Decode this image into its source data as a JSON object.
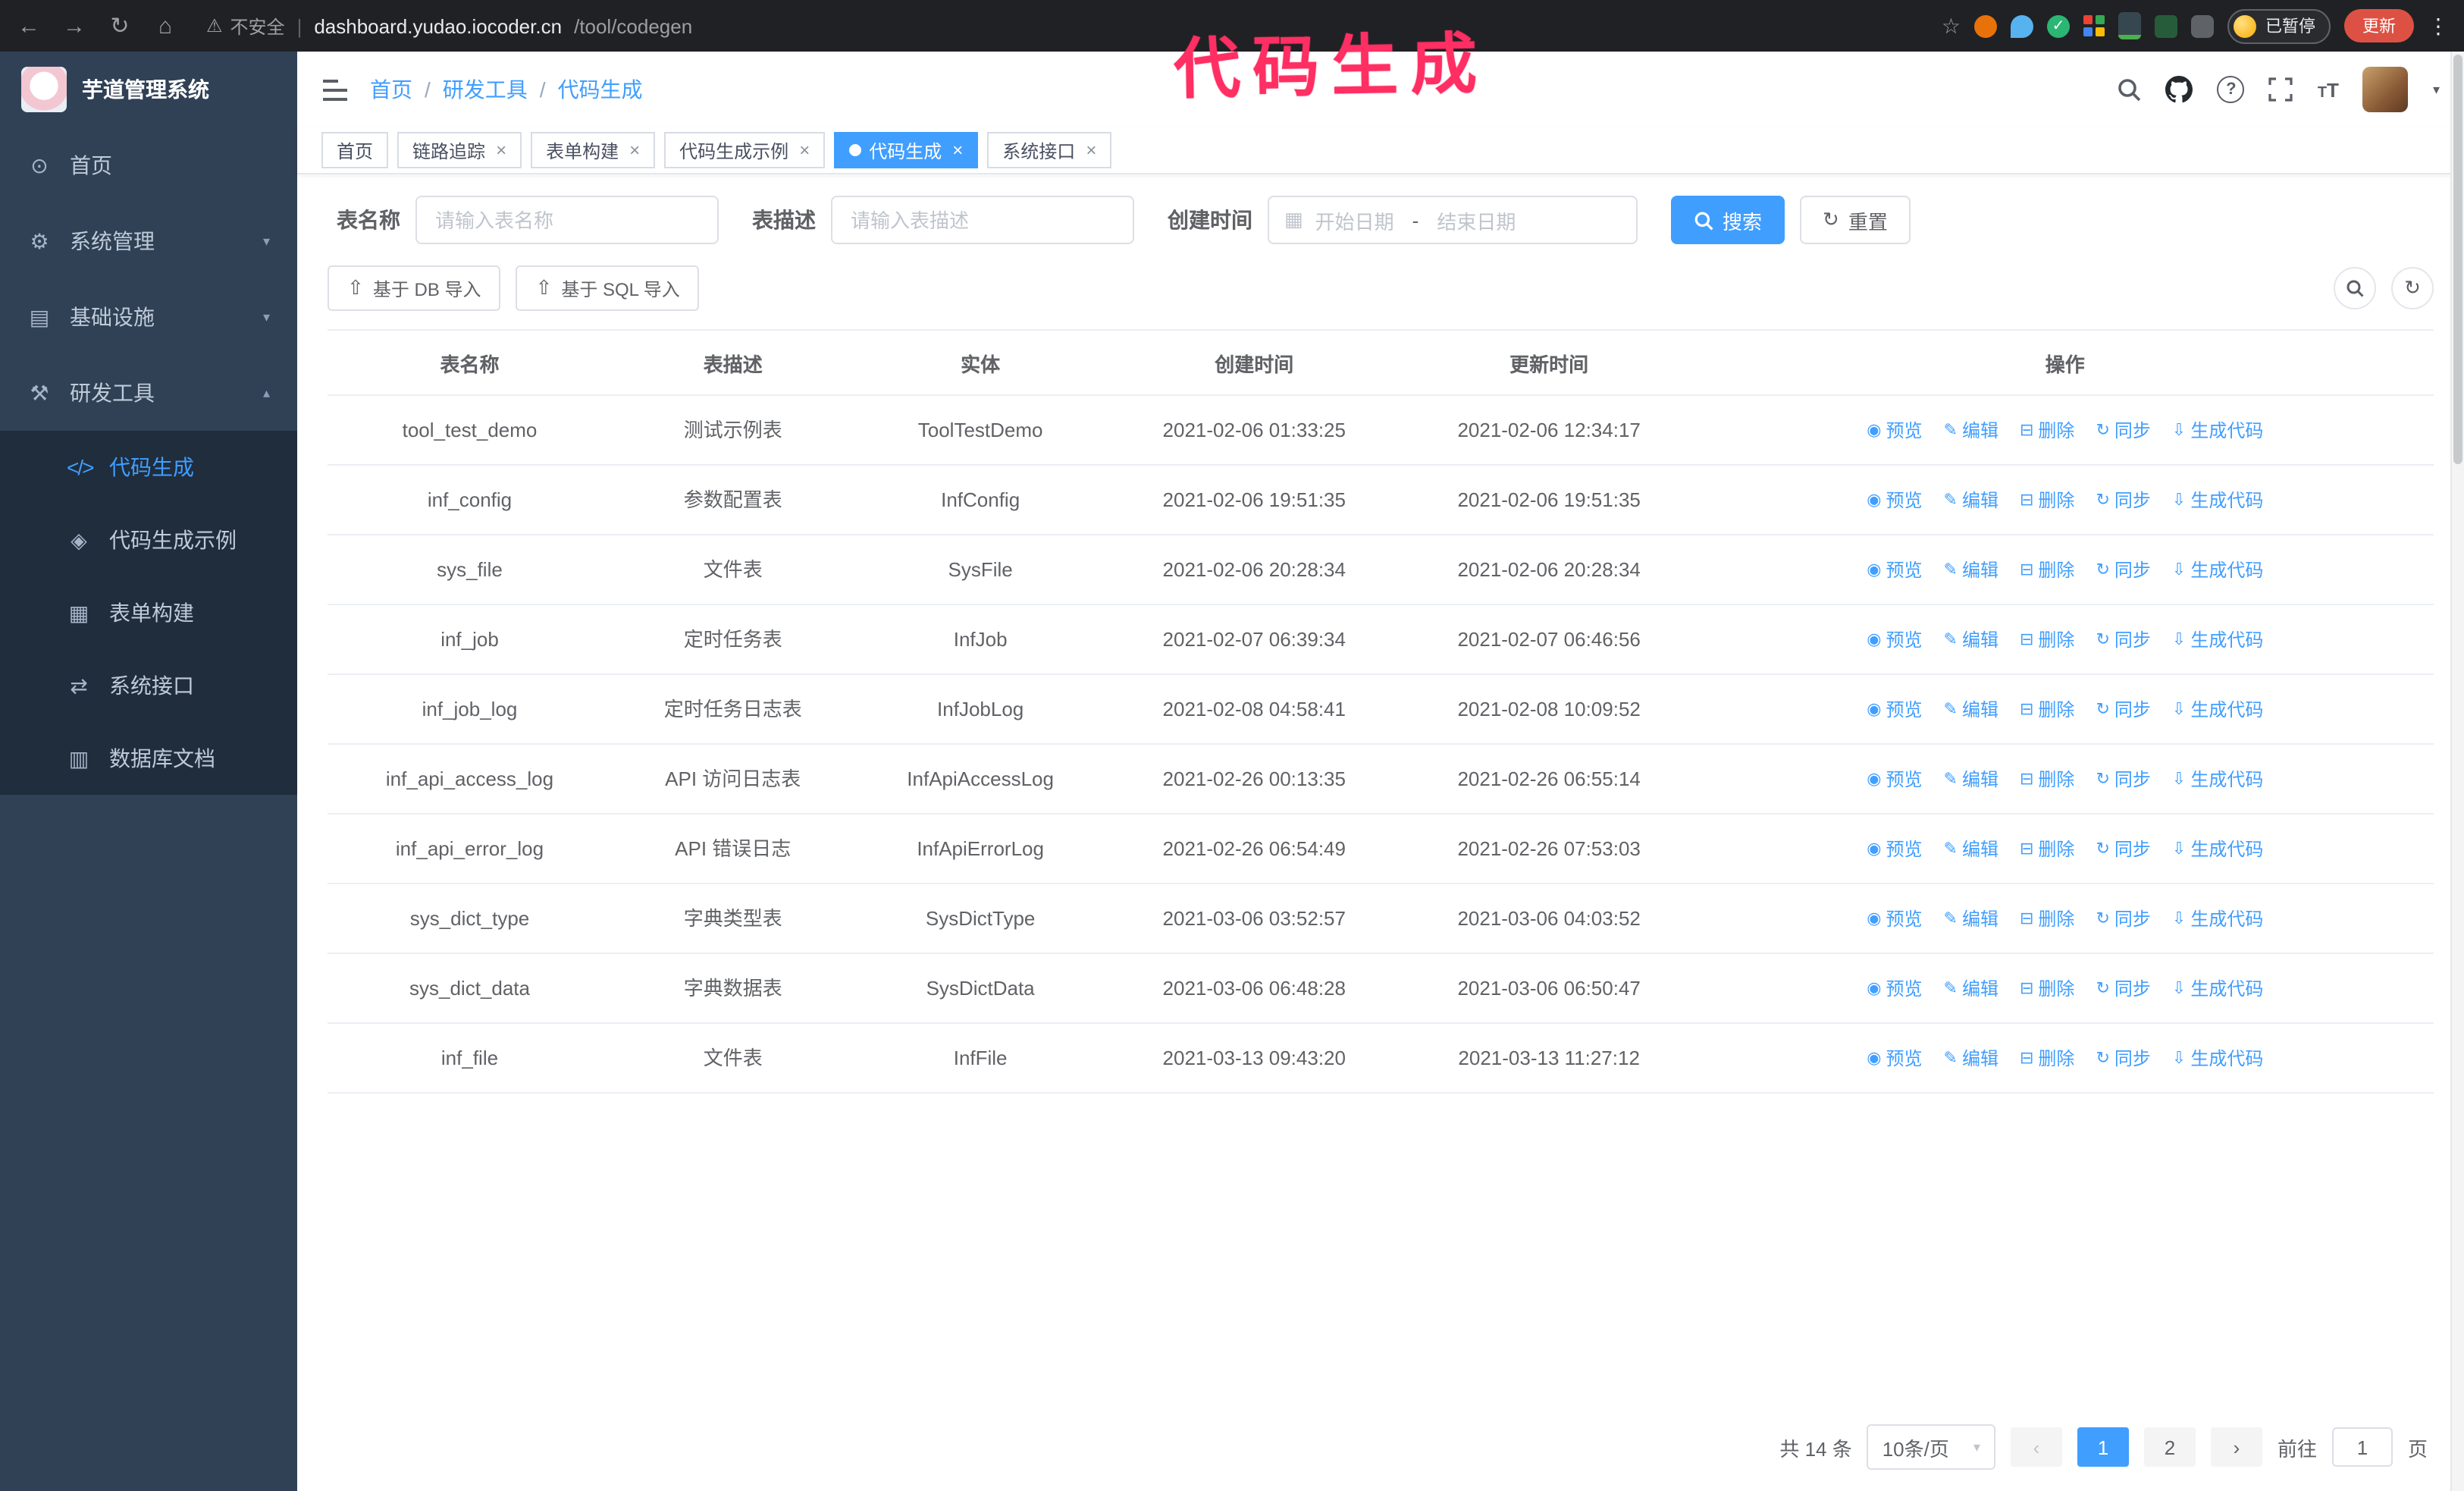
{
  "browser": {
    "security": "不安全",
    "url_host": "dashboard.yudao.iocoder.cn",
    "url_path": "/tool/codegen",
    "paused_chip": "已暂停",
    "update_button": "更新"
  },
  "annotation": "代码生成",
  "sidebar": {
    "title": "芋道管理系统",
    "items": [
      {
        "label": "首页",
        "icon": "dashboard-icon"
      },
      {
        "label": "系统管理",
        "icon": "gear-icon"
      },
      {
        "label": "基础设施",
        "icon": "infrastructure-icon"
      },
      {
        "label": "研发工具",
        "icon": "tools-icon"
      }
    ],
    "submenu": [
      {
        "label": "代码生成",
        "icon": "code-icon",
        "active": true
      },
      {
        "label": "代码生成示例",
        "icon": "example-icon"
      },
      {
        "label": "表单构建",
        "icon": "form-builder-icon"
      },
      {
        "label": "系统接口",
        "icon": "api-icon"
      },
      {
        "label": "数据库文档",
        "icon": "database-doc-icon"
      }
    ]
  },
  "breadcrumb": {
    "items": [
      "首页",
      "研发工具",
      "代码生成"
    ],
    "separator": "/"
  },
  "tabs": [
    {
      "label": "首页",
      "closable": false
    },
    {
      "label": "链路追踪",
      "closable": true
    },
    {
      "label": "表单构建",
      "closable": true
    },
    {
      "label": "代码生成示例",
      "closable": true
    },
    {
      "label": "代码生成",
      "closable": true,
      "active": true
    },
    {
      "label": "系统接口",
      "closable": true
    }
  ],
  "filters": {
    "table_name_label": "表名称",
    "table_name_placeholder": "请输入表名称",
    "table_desc_label": "表描述",
    "table_desc_placeholder": "请输入表描述",
    "create_time_label": "创建时间",
    "date_start_placeholder": "开始日期",
    "date_separator": "-",
    "date_end_placeholder": "结束日期",
    "search_button": "搜索",
    "reset_button": "重置"
  },
  "toolbar": {
    "import_db_button": "基于 DB 导入",
    "import_sql_button": "基于 SQL 导入"
  },
  "table": {
    "columns": [
      "表名称",
      "表描述",
      "实体",
      "创建时间",
      "更新时间",
      "操作"
    ],
    "actions": [
      {
        "label": "预览",
        "name": "preview",
        "icon": "eye"
      },
      {
        "label": "编辑",
        "name": "edit",
        "icon": "edit"
      },
      {
        "label": "删除",
        "name": "delete",
        "icon": "trash"
      },
      {
        "label": "同步",
        "name": "sync",
        "icon": "refresh"
      },
      {
        "label": "生成代码",
        "name": "generate-code",
        "icon": "download"
      }
    ],
    "rows": [
      {
        "name": "tool_test_demo",
        "desc": "测试示例表",
        "entity": "ToolTestDemo",
        "created": "2021-02-06 01:33:25",
        "updated": "2021-02-06 12:34:17"
      },
      {
        "name": "inf_config",
        "desc": "参数配置表",
        "entity": "InfConfig",
        "created": "2021-02-06 19:51:35",
        "updated": "2021-02-06 19:51:35"
      },
      {
        "name": "sys_file",
        "desc": "文件表",
        "entity": "SysFile",
        "created": "2021-02-06 20:28:34",
        "updated": "2021-02-06 20:28:34"
      },
      {
        "name": "inf_job",
        "desc": "定时任务表",
        "entity": "InfJob",
        "created": "2021-02-07 06:39:34",
        "updated": "2021-02-07 06:46:56"
      },
      {
        "name": "inf_job_log",
        "desc": "定时任务日志表",
        "entity": "InfJobLog",
        "created": "2021-02-08 04:58:41",
        "updated": "2021-02-08 10:09:52"
      },
      {
        "name": "inf_api_access_log",
        "desc": "API 访问日志表",
        "entity": "InfApiAccessLog",
        "created": "2021-02-26 00:13:35",
        "updated": "2021-02-26 06:55:14"
      },
      {
        "name": "inf_api_error_log",
        "desc": "API 错误日志",
        "entity": "InfApiErrorLog",
        "created": "2021-02-26 06:54:49",
        "updated": "2021-02-26 07:53:03"
      },
      {
        "name": "sys_dict_type",
        "desc": "字典类型表",
        "entity": "SysDictType",
        "created": "2021-03-06 03:52:57",
        "updated": "2021-03-06 04:03:52"
      },
      {
        "name": "sys_dict_data",
        "desc": "字典数据表",
        "entity": "SysDictData",
        "created": "2021-03-06 06:48:28",
        "updated": "2021-03-06 06:50:47"
      },
      {
        "name": "inf_file",
        "desc": "文件表",
        "entity": "InfFile",
        "created": "2021-03-13 09:43:20",
        "updated": "2021-03-13 11:27:12"
      }
    ]
  },
  "pagination": {
    "total": "共 14 条",
    "page_size": "10条/页",
    "pages": [
      "1",
      "2"
    ],
    "active_page": "1",
    "prev": "‹",
    "next": "›",
    "goto_prefix": "前往",
    "goto_value": "1",
    "goto_suffix": "页"
  },
  "icon_glyphs": {
    "eye": "◉",
    "edit": "✎",
    "trash": "⊟",
    "refresh": "↻",
    "download": "⇩"
  },
  "colors": {
    "primary": "#409eff",
    "sidebar_bg": "#304156",
    "submenu_bg": "#1f2d3d",
    "chrome_bg": "#202124",
    "annotation": "#ff2e63",
    "update_red": "#dd5144"
  }
}
